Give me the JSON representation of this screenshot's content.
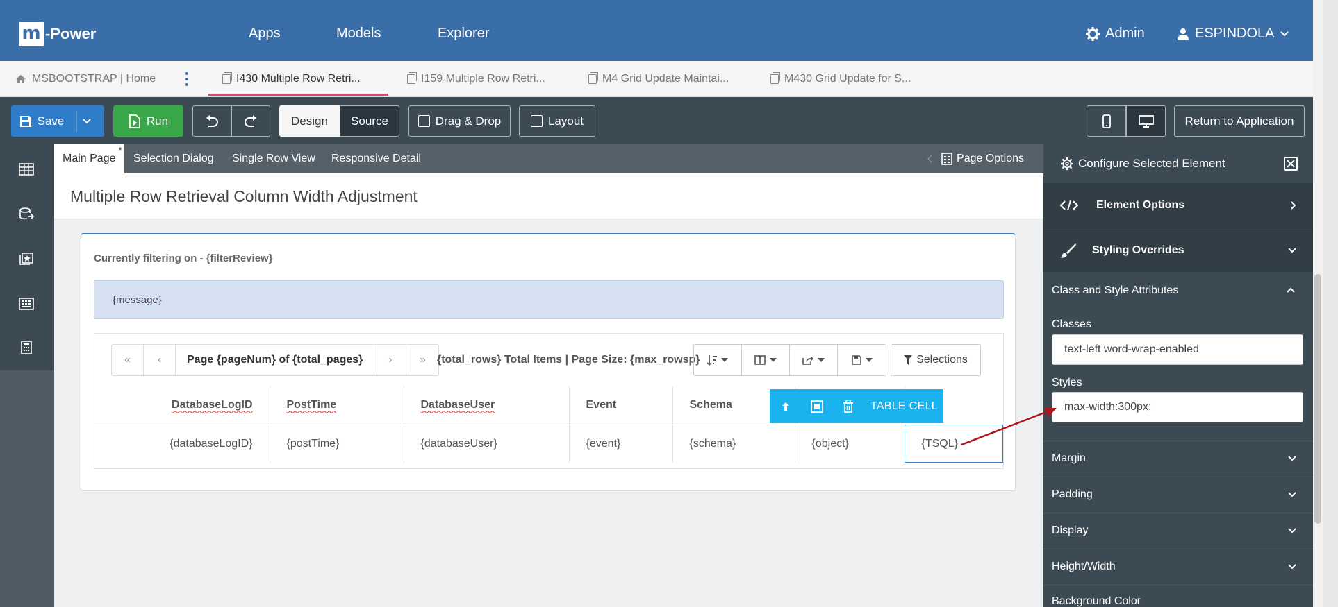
{
  "app": {
    "logo_letter": "m",
    "logo_text": "-Power"
  },
  "topnav": {
    "links": [
      "Apps",
      "Models",
      "Explorer"
    ],
    "admin_label": "Admin",
    "user_label": "ESPINDOLA"
  },
  "tabs": {
    "home": "MSBOOTSTRAP | Home",
    "items": [
      "I430 Multiple Row Retri...",
      "I159 Multiple Row Retri...",
      "M4 Grid Update Maintai...",
      "M430 Grid Update for S..."
    ],
    "active_index": 0
  },
  "toolbar": {
    "save": "Save",
    "run": "Run",
    "design": "Design",
    "source": "Source",
    "drag_drop": "Drag & Drop",
    "layout": "Layout",
    "return": "Return to Application"
  },
  "page_tabs": {
    "main": "Main Page",
    "main_marker": "*",
    "selection": "Selection Dialog",
    "single": "Single Row View",
    "responsive": "Responsive Detail",
    "page_options": "Page Options"
  },
  "page": {
    "title": "Multiple Row Retrieval Column Width Adjustment",
    "filter_text": "Currently filtering on - {filterReview}",
    "message": "{message}",
    "pager_label": "Page {pageNum} of {total_pages}",
    "totals": "{total_rows} Total Items | Page Size: {max_rowsp}",
    "selections": "Selections"
  },
  "grid": {
    "headers": [
      "DatabaseLogID",
      "PostTime",
      "DatabaseUser",
      "Event",
      "Schema",
      "",
      ""
    ],
    "row": [
      "{databaseLogID}",
      "{postTime}",
      "{databaseUser}",
      "{event}",
      "{schema}",
      "{object}",
      "{TSQL}"
    ]
  },
  "cell_toolbar": {
    "label": "TABLE CELL"
  },
  "right_panel": {
    "title": "Configure Selected Element",
    "element_options": "Element Options",
    "styling_overrides": "Styling Overrides",
    "class_style_title": "Class and Style Attributes",
    "classes_label": "Classes",
    "classes_value": "text-left word-wrap-enabled",
    "styles_label": "Styles",
    "styles_value": "max-width:300px;",
    "sections": [
      "Margin",
      "Padding",
      "Display",
      "Height/Width",
      "Background Color"
    ]
  },
  "colors": {
    "nav_blue": "#3a6ea8",
    "toolbar_dark": "#3c4a53",
    "save_blue": "#2f7cc9",
    "run_green": "#3aa84a",
    "active_tab_pink": "#e2426f",
    "cell_toolbar_cyan": "#1ab3ef",
    "arrow_red": "#b0141c"
  }
}
